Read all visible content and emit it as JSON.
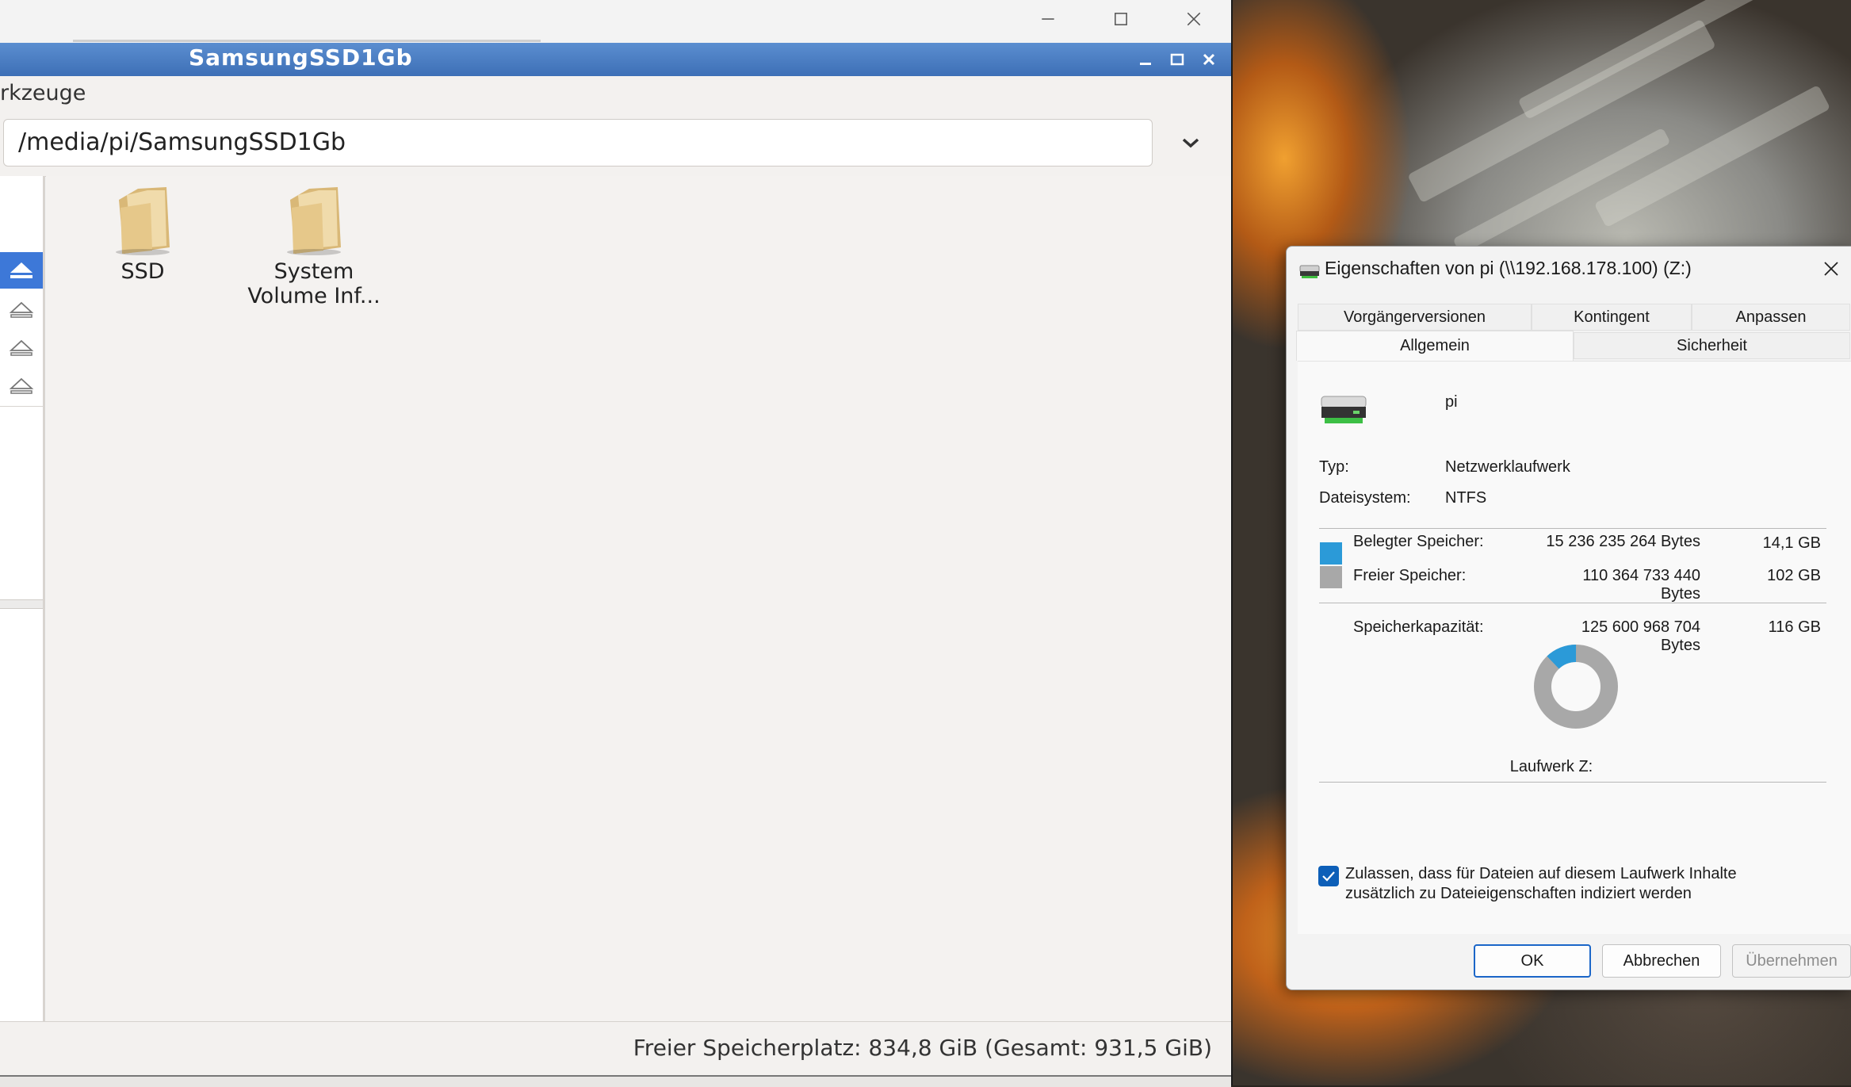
{
  "file_manager": {
    "window_title": "SamsungSSD1Gb",
    "menu_partial": "rkzeuge",
    "path": "/media/pi/SamsungSSD1Gb",
    "items": [
      {
        "label_line1": "SSD",
        "label_line2": ""
      },
      {
        "label_line1": "System",
        "label_line2": "Volume Inf..."
      }
    ],
    "status": "Freier Speicherplatz: 834,8 GiB (Gesamt: 931,5 GiB)"
  },
  "dialog": {
    "title": "Eigenschaften von pi (\\\\192.168.178.100) (Z:)",
    "tabs_row1": [
      "Vorgängerversionen",
      "Kontingent",
      "Anpassen"
    ],
    "tabs_row2": [
      "Allgemein",
      "Sicherheit"
    ],
    "active_tab": "Allgemein",
    "drive_name": "pi",
    "type_label": "Typ:",
    "type_value": "Netzwerklaufwerk",
    "fs_label": "Dateisystem:",
    "fs_value": "NTFS",
    "used_label": "Belegter Speicher:",
    "used_bytes": "15 236 235 264 Bytes",
    "used_size": "14,1 GB",
    "free_label": "Freier Speicher:",
    "free_bytes": "110 364 733 440 Bytes",
    "free_size": "102 GB",
    "cap_label": "Speicherkapazität:",
    "cap_bytes": "125 600 968 704 Bytes",
    "cap_size": "116 GB",
    "drive_label": "Laufwerk Z:",
    "used_fraction": 0.121,
    "used_color": "#2b9ad8",
    "free_color": "#a8a8a8",
    "index_checkbox_line1": "Zulassen, dass für Dateien auf diesem Laufwerk Inhalte",
    "index_checkbox_line2": "zusätzlich zu Dateieigenschaften indiziert werden",
    "index_checked": true,
    "ok": "OK",
    "cancel": "Abbrechen",
    "apply": "Übernehmen"
  }
}
